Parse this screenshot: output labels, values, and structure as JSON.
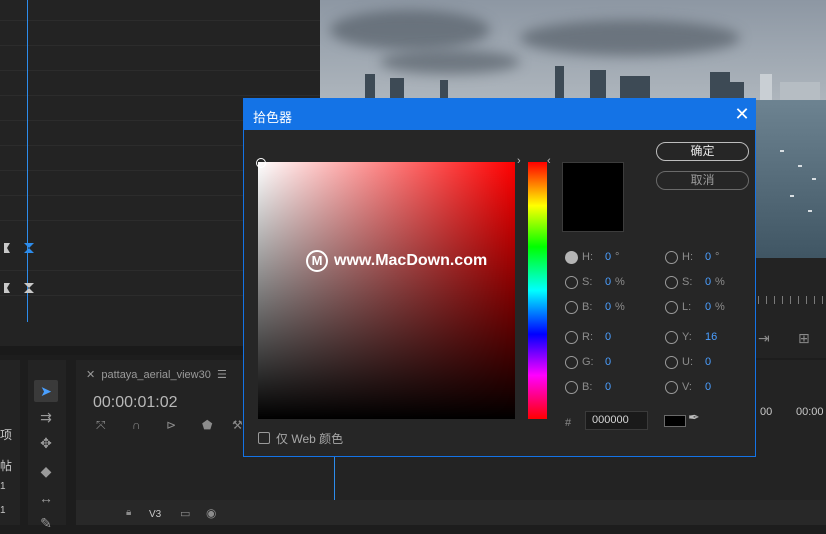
{
  "background": {
    "sequence_tab": "pattaya_aerial_view30",
    "timecode": "00:00:01:02",
    "track_label": "V3",
    "ruler_times": [
      "00",
      "00:00"
    ],
    "left_edge_chars": [
      "项",
      "帖",
      "1",
      "1"
    ]
  },
  "dialog": {
    "title": "拾色器",
    "ok_label": "确定",
    "cancel_label": "取消",
    "web_only_label": "仅 Web 颜色",
    "hex_prefix": "#",
    "hex_value": "000000",
    "current_color": "#000000",
    "selected_mode": "H",
    "fields_left": [
      {
        "label": "H:",
        "value": "0",
        "unit": "°"
      },
      {
        "label": "S:",
        "value": "0",
        "unit": "%"
      },
      {
        "label": "B:",
        "value": "0",
        "unit": "%"
      },
      {
        "label": "R:",
        "value": "0",
        "unit": ""
      },
      {
        "label": "G:",
        "value": "0",
        "unit": ""
      },
      {
        "label": "B:",
        "value": "0",
        "unit": ""
      }
    ],
    "fields_right": [
      {
        "label": "H:",
        "value": "0",
        "unit": "°"
      },
      {
        "label": "S:",
        "value": "0",
        "unit": "%"
      },
      {
        "label": "L:",
        "value": "0",
        "unit": "%"
      },
      {
        "label": "Y:",
        "value": "16",
        "unit": ""
      },
      {
        "label": "U:",
        "value": "0",
        "unit": ""
      },
      {
        "label": "V:",
        "value": "0",
        "unit": ""
      }
    ]
  },
  "watermark": {
    "logo": "M",
    "text": "www.MacDown.com"
  },
  "colors": {
    "accent": "#1473e6",
    "value_blue": "#4a9eff",
    "panel": "#232323"
  },
  "icons": [
    "close-icon",
    "eyedropper-icon",
    "selection-tool-icon",
    "track-select-icon",
    "ripple-edit-icon",
    "razor-icon",
    "slip-icon",
    "pen-icon",
    "lock-icon",
    "eye-icon"
  ]
}
